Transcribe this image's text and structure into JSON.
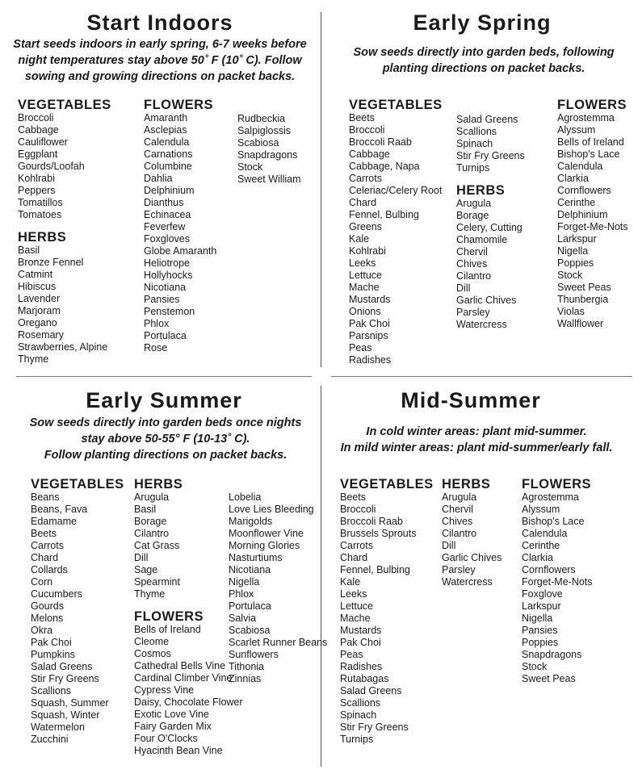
{
  "sections": {
    "start_indoors": {
      "title": "Start Indoors",
      "subtitle": [
        "Start seeds indoors in early spring, 6-7 weeks before",
        "night temperatures stay above 50˚ F (10˚ C). Follow",
        "sowing and growing directions on packet backs."
      ],
      "columns": [
        [
          {
            "heading": "VEGETABLES",
            "items": [
              "Broccoli",
              "Cabbage",
              "Cauliflower",
              "Eggplant",
              "Gourds/Loofah",
              "Kohlrabi",
              "Peppers",
              "Tomatillos",
              "Tomatoes"
            ]
          },
          {
            "heading": "HERBS",
            "items": [
              "Basil",
              "Bronze Fennel",
              "Catmint",
              "Hibiscus",
              "Lavender",
              "Marjoram",
              "Oregano",
              "Rosemary",
              "Strawberries, Alpine",
              "Thyme"
            ]
          }
        ],
        [
          {
            "heading": "FLOWERS",
            "items": [
              "Amaranth",
              "Asclepias",
              "Calendula",
              "Carnations",
              "Columbine",
              "Dahlia",
              "Delphinium",
              "Dianthus",
              "Echinacea",
              "Feverfew",
              "Foxgloves",
              "Globe Amaranth",
              "Heliotrope",
              "Hollyhocks",
              "Nicotiana",
              "Pansies",
              "Penstemon",
              "Phlox",
              "Portulaca",
              "Rose"
            ]
          }
        ],
        [
          {
            "heading": "",
            "items": [
              "Rudbeckia",
              "Salpiglossis",
              "Scabiosa",
              "Snapdragons",
              "Stock",
              "Sweet William"
            ]
          }
        ]
      ]
    },
    "early_spring": {
      "title": "Early Spring",
      "subtitle": [
        "Sow seeds directly into garden beds, following",
        "planting directions on packet backs."
      ],
      "columns": [
        [
          {
            "heading": "VEGETABLES",
            "items": [
              "Beets",
              "Broccoli",
              "Broccoli Raab",
              "Cabbage",
              "Cabbage, Napa",
              "Carrots",
              "Celeriac/Celery Root",
              "Chard",
              "Fennel, Bulbing",
              "Greens",
              "Kale",
              "Kohlrabi",
              "Leeks",
              "Lettuce",
              "Mache",
              "Mustards",
              "Onions",
              "Pak Choi",
              "Parsnips",
              "Peas",
              "Radishes"
            ]
          }
        ],
        [
          {
            "heading": "",
            "items": [
              "Salad Greens",
              "Scallions",
              "Spinach",
              "Stir Fry Greens",
              "Turnips"
            ]
          },
          {
            "heading": "HERBS",
            "items": [
              "Arugula",
              "Borage",
              "Celery, Cutting",
              "Chamomile",
              "Chervil",
              "Chives",
              "Cilantro",
              "Dill",
              "Garlic Chives",
              "Parsley",
              "Watercress"
            ]
          }
        ],
        [
          {
            "heading": "FLOWERS",
            "items": [
              "Agrostemma",
              "Alyssum",
              "Bells of Ireland",
              "Bishop's Lace",
              "Calendula",
              "Clarkia",
              "Cornflowers",
              "Cerinthe",
              "Delphinium",
              "Forget-Me-Nots",
              "Larkspur",
              "Nigella",
              "Poppies",
              "Stock",
              "Sweet Peas",
              "Thunbergia",
              "Violas",
              "Wallflower"
            ]
          }
        ]
      ]
    },
    "early_summer": {
      "title": "Early Summer",
      "subtitle": [
        "Sow seeds directly into garden beds once nights",
        "stay above 50-55° F (10-13˚ C).",
        "Follow planting directions on packet backs."
      ],
      "columns": [
        [
          {
            "heading": "VEGETABLES",
            "items": [
              "Beans",
              "Beans, Fava",
              "Edamame",
              "Beets",
              "Carrots",
              "Chard",
              "Collards",
              "Corn",
              "Cucumbers",
              "Gourds",
              "Melons",
              "Okra",
              "Pak Choi",
              "Pumpkins",
              "Salad Greens",
              "Stir Fry Greens",
              "Scallions",
              "Squash, Summer",
              "Squash, Winter",
              "Watermelon",
              "Zucchini"
            ]
          }
        ],
        [
          {
            "heading": "HERBS",
            "items": [
              "Arugula",
              "Basil",
              "Borage",
              "Cilantro",
              "Cat Grass",
              "Dill",
              "Sage",
              "Spearmint",
              "Thyme"
            ]
          },
          {
            "heading": "FLOWERS",
            "items": [
              "Bells of Ireland",
              "Cleome",
              "Cosmos",
              "Cathedral Bells Vine",
              "Cardinal Climber Vine",
              "Cypress Vine",
              "Daisy, Chocolate Flower",
              "Exotic Love Vine",
              "Fairy Garden Mix",
              "Four O'Clocks",
              "Hyacinth Bean Vine"
            ]
          }
        ],
        [
          {
            "heading": "",
            "items": [
              "Lobelia",
              "Love Lies Bleeding",
              "Marigolds",
              "Moonflower Vine",
              "Morning Glories",
              "Nasturtiums",
              "Nicotiana",
              "Nigella",
              "Phlox",
              "Portulaca",
              "Salvia",
              "Scabiosa",
              "Scarlet Runner Beans",
              "Sunflowers",
              "Tithonia",
              "Zinnias"
            ]
          }
        ]
      ]
    },
    "mid_summer": {
      "title": "Mid-Summer",
      "subtitle": [
        "In cold winter areas: plant mid-summer.",
        "In mild winter areas: plant mid-summer/early fall."
      ],
      "columns": [
        [
          {
            "heading": "VEGETABLES",
            "items": [
              "Beets",
              "Broccoli",
              "Broccoli Raab",
              "Brussels Sprouts",
              "Carrots",
              "Chard",
              "Fennel, Bulbing",
              "Kale",
              "Leeks",
              "Lettuce",
              "Mache",
              "Mustards",
              "Pak Choi",
              "Peas",
              "Radishes",
              "Rutabagas",
              "Salad Greens",
              "Scallions",
              "Spinach",
              "Stir Fry Greens",
              "Turnips"
            ]
          }
        ],
        [
          {
            "heading": "HERBS",
            "items": [
              "Arugula",
              "Chervil",
              "Chives",
              "Cilantro",
              "Dill",
              "Garlic Chives",
              "Parsley",
              "Watercress"
            ]
          }
        ],
        [
          {
            "heading": "FLOWERS",
            "items": [
              "Agrostemma",
              "Alyssum",
              "Bishop's Lace",
              "Calendula",
              "Cerinthe",
              "Clarkia",
              "Cornflowers",
              "Forget-Me-Nots",
              "Foxglove",
              "Larkspur",
              "Nigella",
              "Pansies",
              "Poppies",
              "Snapdragons",
              "Stock",
              "Sweet Peas"
            ]
          }
        ]
      ]
    }
  }
}
